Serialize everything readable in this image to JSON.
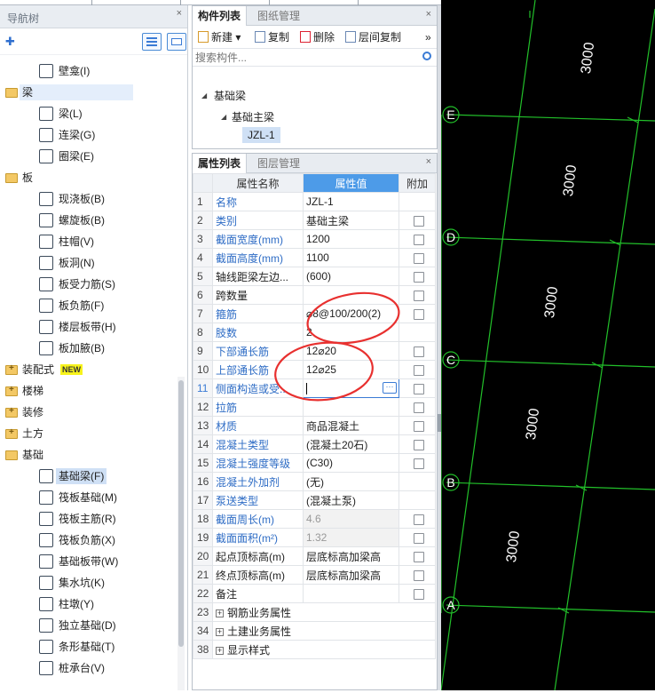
{
  "nav": {
    "title": "导航树",
    "pin": "×",
    "tree": [
      {
        "label": "壁龛(I)",
        "level": 2,
        "icon": "niche-icon"
      },
      {
        "label": "梁",
        "level": 1,
        "icon": "folder-open-icon",
        "selected_row": true
      },
      {
        "label": "梁(L)",
        "level": 2,
        "icon": "beam-icon"
      },
      {
        "label": "连梁(G)",
        "level": 2,
        "icon": "coupling-beam-icon"
      },
      {
        "label": "圈梁(E)",
        "level": 2,
        "icon": "ring-beam-icon"
      },
      {
        "label": "板",
        "level": 1,
        "icon": "folder-open-icon"
      },
      {
        "label": "现浇板(B)",
        "level": 2,
        "icon": "cast-slab-icon"
      },
      {
        "label": "螺旋板(B)",
        "level": 2,
        "icon": "spiral-slab-icon"
      },
      {
        "label": "柱帽(V)",
        "level": 2,
        "icon": "column-cap-icon"
      },
      {
        "label": "板洞(N)",
        "level": 2,
        "icon": "slab-hole-icon"
      },
      {
        "label": "板受力筋(S)",
        "level": 2,
        "icon": "slab-rebar-icon"
      },
      {
        "label": "板负筋(F)",
        "level": 2,
        "icon": "negative-rebar-icon"
      },
      {
        "label": "楼层板带(H)",
        "level": 2,
        "icon": "slab-strip-icon"
      },
      {
        "label": "板加腋(B)",
        "level": 2,
        "icon": "slab-haunch-icon"
      },
      {
        "label": "装配式",
        "level": 1,
        "icon": "folder-closed-icon",
        "badge": "NEW"
      },
      {
        "label": "楼梯",
        "level": 1,
        "icon": "folder-closed-icon"
      },
      {
        "label": "装修",
        "level": 1,
        "icon": "folder-closed-icon"
      },
      {
        "label": "土方",
        "level": 1,
        "icon": "folder-closed-icon"
      },
      {
        "label": "基础",
        "level": 1,
        "icon": "folder-open-icon"
      },
      {
        "label": "基础梁(F)",
        "level": 2,
        "icon": "foundation-beam-icon",
        "selected": true
      },
      {
        "label": "筏板基础(M)",
        "level": 2,
        "icon": "raft-foundation-icon"
      },
      {
        "label": "筏板主筋(R)",
        "level": 2,
        "icon": "raft-main-rebar-icon"
      },
      {
        "label": "筏板负筋(X)",
        "level": 2,
        "icon": "raft-negative-rebar-icon"
      },
      {
        "label": "基础板带(W)",
        "level": 2,
        "icon": "foundation-strip-icon"
      },
      {
        "label": "集水坑(K)",
        "level": 2,
        "icon": "sump-pit-icon"
      },
      {
        "label": "柱墩(Y)",
        "level": 2,
        "icon": "column-pier-icon"
      },
      {
        "label": "独立基础(D)",
        "level": 2,
        "icon": "isolated-footing-icon"
      },
      {
        "label": "条形基础(T)",
        "level": 2,
        "icon": "strip-footing-icon"
      },
      {
        "label": "桩承台(V)",
        "level": 2,
        "icon": "pile-cap-icon"
      }
    ]
  },
  "component_panel": {
    "tabs": [
      "构件列表",
      "图纸管理"
    ],
    "toolbar": {
      "new": "新建",
      "copy": "复制",
      "delete": "删除",
      "floor_copy": "层间复制",
      "more": "»"
    },
    "search_placeholder": "搜索构件...",
    "tree": {
      "root": "基础梁",
      "child": "基础主梁",
      "item": "JZL-1"
    }
  },
  "property_panel": {
    "tabs": [
      "属性列表",
      "图层管理"
    ],
    "headers": {
      "name": "属性名称",
      "value": "属性值",
      "extra": "附加"
    },
    "rows": [
      {
        "n": "1",
        "name": "名称",
        "value": "JZL-1",
        "blue": true,
        "cb": false
      },
      {
        "n": "2",
        "name": "类别",
        "value": "基础主梁",
        "blue": true,
        "cb": true
      },
      {
        "n": "3",
        "name": "截面宽度(mm)",
        "value": "1200",
        "blue": true,
        "cb": true
      },
      {
        "n": "4",
        "name": "截面高度(mm)",
        "value": "1100",
        "blue": true,
        "cb": true
      },
      {
        "n": "5",
        "name": "轴线距梁左边...",
        "value": "(600)",
        "blue": false,
        "cb": true
      },
      {
        "n": "6",
        "name": "跨数量",
        "value": "",
        "blue": false,
        "cb": true
      },
      {
        "n": "7",
        "name": "箍筋",
        "value": "⌀8@100/200(2)",
        "blue": true,
        "cb": true
      },
      {
        "n": "8",
        "name": "肢数",
        "value": "2",
        "blue": true,
        "cb": false
      },
      {
        "n": "9",
        "name": "下部通长筋",
        "value": "12⌀20",
        "blue": true,
        "cb": true
      },
      {
        "n": "10",
        "name": "上部通长筋",
        "value": "12⌀25",
        "blue": true,
        "cb": true
      },
      {
        "n": "11",
        "name": "侧面构造或受...",
        "value": "",
        "blue": true,
        "cb": true,
        "editing": true
      },
      {
        "n": "12",
        "name": "拉筋",
        "value": "",
        "blue": true,
        "cb": true
      },
      {
        "n": "13",
        "name": "材质",
        "value": "商品混凝土",
        "blue": true,
        "cb": true
      },
      {
        "n": "14",
        "name": "混凝土类型",
        "value": "(混凝土20石)",
        "blue": true,
        "cb": true
      },
      {
        "n": "15",
        "name": "混凝土强度等级",
        "value": "(C30)",
        "blue": true,
        "cb": true
      },
      {
        "n": "16",
        "name": "混凝土外加剂",
        "value": "(无)",
        "blue": true,
        "cb": false
      },
      {
        "n": "17",
        "name": "泵送类型",
        "value": "(混凝土泵)",
        "blue": true,
        "cb": false
      },
      {
        "n": "18",
        "name": "截面周长(m)",
        "value": "4.6",
        "blue": true,
        "cb": true,
        "gray": true
      },
      {
        "n": "19",
        "name": "截面面积(m²)",
        "value": "1.32",
        "blue": true,
        "cb": true,
        "gray": true
      },
      {
        "n": "20",
        "name": "起点顶标高(m)",
        "value": "层底标高加梁高",
        "blue": false,
        "cb": true
      },
      {
        "n": "21",
        "name": "终点顶标高(m)",
        "value": "层底标高加梁高",
        "blue": false,
        "cb": true
      },
      {
        "n": "22",
        "name": "备注",
        "value": "",
        "blue": false,
        "cb": true
      },
      {
        "n": "23",
        "name": "钢筋业务属性",
        "value": "",
        "group": true
      },
      {
        "n": "34",
        "name": "土建业务属性",
        "value": "",
        "group": true
      },
      {
        "n": "38",
        "name": "显示样式",
        "value": "",
        "group": true
      }
    ]
  },
  "cad": {
    "axes": [
      "E",
      "D",
      "C",
      "B",
      "A"
    ],
    "dimension": "3000",
    "grid_color": "#22c02a",
    "text_color": "#ffffff"
  },
  "colors": {
    "accent": "#4d9be8",
    "annotation": "#e8302f",
    "select": "#cfe0f5"
  }
}
